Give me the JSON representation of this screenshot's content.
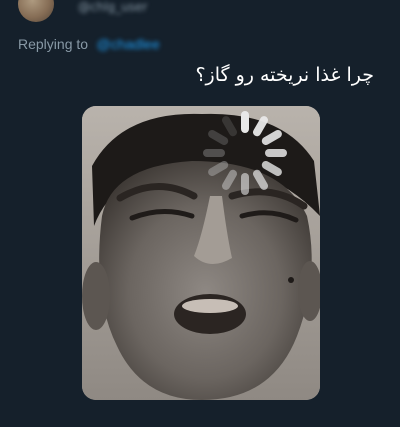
{
  "reply": {
    "author_handle": "@chlg_user",
    "label": "Replying to",
    "target_handle": "@chadlee"
  },
  "tweet": {
    "text": "چرا غذا نریخته رو گاز؟",
    "media": {
      "type": "photo",
      "overlay_icon": "loading-spinner-icon"
    }
  },
  "colors": {
    "background": "#15202b",
    "secondary_text": "#8899a6",
    "accent": "#1d9bf0",
    "primary_text": "#ffffff"
  }
}
